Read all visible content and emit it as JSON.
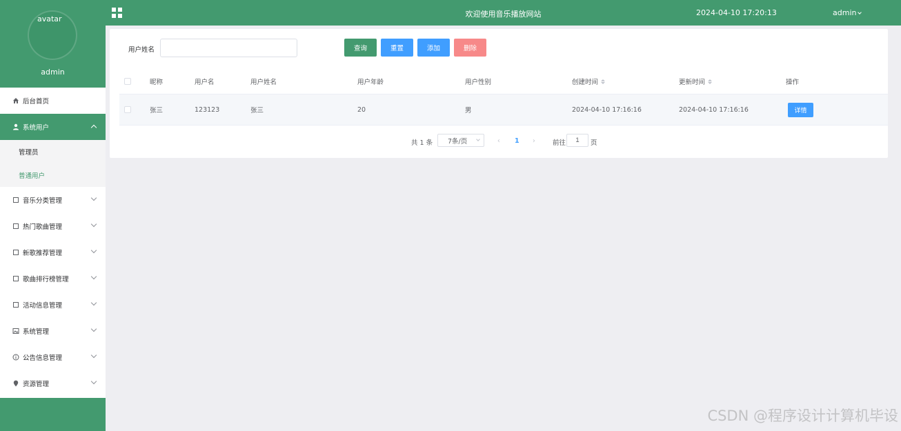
{
  "header": {
    "title": "欢迎使用音乐播放网站",
    "time": "2024-04-10 17:20:13",
    "user": "admin"
  },
  "sidebar": {
    "avatar_alt": "avatar",
    "username": "admin",
    "items": [
      {
        "label": "后台首页",
        "icon": "home-icon"
      },
      {
        "label": "系统用户",
        "icon": "user-icon"
      },
      {
        "label": "音乐分类管理",
        "icon": "document-icon"
      },
      {
        "label": "热门歌曲管理",
        "icon": "document-icon"
      },
      {
        "label": "新歌推荐管理",
        "icon": "document-icon"
      },
      {
        "label": "歌曲排行榜管理",
        "icon": "document-icon"
      },
      {
        "label": "活动信息管理",
        "icon": "document-icon"
      },
      {
        "label": "系统管理",
        "icon": "picture-icon"
      },
      {
        "label": "公告信息管理",
        "icon": "info-icon"
      },
      {
        "label": "资源管理",
        "icon": "location-icon"
      }
    ],
    "submenu": [
      "管理员",
      "普通用户"
    ]
  },
  "search": {
    "label": "用户姓名",
    "value": "",
    "query": "查询",
    "reset": "重置",
    "add": "添加",
    "delete": "删除"
  },
  "table": {
    "columns": [
      "昵称",
      "用户名",
      "用户姓名",
      "用户年龄",
      "用户性别",
      "创建时间",
      "更新时间",
      "操作"
    ],
    "rows": [
      {
        "nickname": "张三",
        "username": "123123",
        "realname": "张三",
        "age": "20",
        "gender": "男",
        "created": "2024-04-10 17:16:16",
        "updated": "2024-04-10 17:16:16",
        "action": "详情"
      }
    ]
  },
  "pagination": {
    "total": "共 1 条",
    "page_size": "7条/页",
    "prev": "‹",
    "current": "1",
    "next": "›",
    "goto_label": "前往",
    "goto_value": "1",
    "page_unit": "页"
  },
  "watermark": "CSDN @程序设计计算机毕设",
  "colors": {
    "primary": "#439a6f",
    "blue": "#409eff",
    "danger": "#f78989"
  }
}
